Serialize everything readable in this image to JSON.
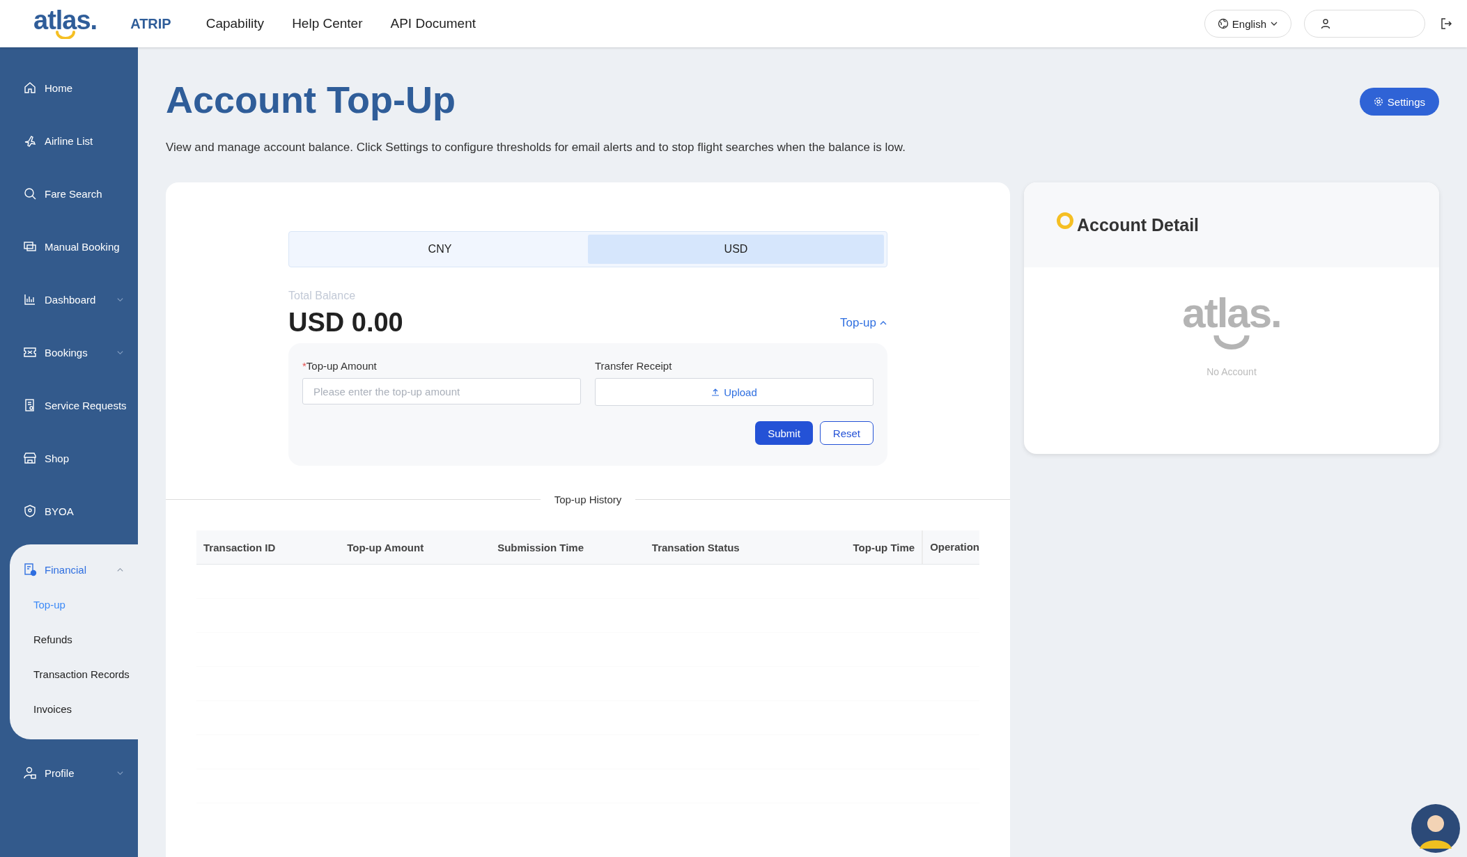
{
  "header": {
    "logo": "atlas.",
    "brand": "ATRIP",
    "nav": [
      "Capability",
      "Help Center",
      "API Document"
    ],
    "language": "English"
  },
  "sidebar": {
    "items": [
      {
        "label": "Home",
        "selected": false
      },
      {
        "label": "Airline List",
        "selected": false
      },
      {
        "label": "Fare Search",
        "selected": false
      },
      {
        "label": "Manual Booking",
        "selected": false
      },
      {
        "label": "Dashboard",
        "selected": false,
        "expanded": false
      },
      {
        "label": "Bookings",
        "selected": false,
        "expanded": false
      },
      {
        "label": "Service Requests",
        "selected": false
      },
      {
        "label": "Shop",
        "selected": false
      },
      {
        "label": "BYOA",
        "selected": false
      },
      {
        "label": "Financial",
        "selected": true,
        "expanded": true,
        "children": [
          {
            "label": "Top-up",
            "selected": true
          },
          {
            "label": "Refunds",
            "selected": false
          },
          {
            "label": "Transaction Records",
            "selected": false
          },
          {
            "label": "Invoices",
            "selected": false
          }
        ]
      },
      {
        "label": "Profile",
        "selected": false,
        "expanded": false
      }
    ]
  },
  "page": {
    "title": "Account Top-Up",
    "description": "View and manage account balance. Click Settings to configure thresholds for email alerts and to stop flight searches when the balance is low.",
    "settings_button": "Settings"
  },
  "currency_tabs": [
    {
      "label": "CNY",
      "selected": false
    },
    {
      "label": "USD",
      "selected": true
    }
  ],
  "balance": {
    "label": "Total Balance",
    "amount": "USD 0.00",
    "toggle": {
      "label": "Top-up",
      "expanded": true
    }
  },
  "form": {
    "amount": {
      "label": "Top-up Amount",
      "required_mark": "*",
      "placeholder": "Please enter the top-up amount"
    },
    "receipt": {
      "label": "Transfer Receipt",
      "button": "Upload"
    },
    "buttons": [
      "Submit",
      "Reset"
    ]
  },
  "history": {
    "title": "Top-up History",
    "columns": [
      "Transaction ID",
      "Top-up Amount",
      "Submission Time",
      "Transation Status",
      "Top-up Time",
      "Operation"
    ]
  },
  "account_detail": {
    "title": "Account Detail",
    "empty_logo": "atlas.",
    "empty_text": "No Account"
  }
}
